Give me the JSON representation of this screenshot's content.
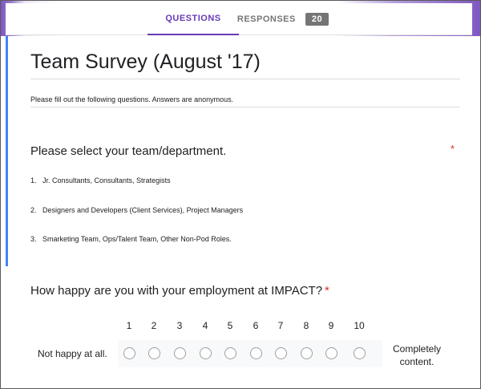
{
  "tabs": {
    "questions_label": "QUESTIONS",
    "responses_label": "RESPONSES",
    "responses_count": "20"
  },
  "form": {
    "title": "Team Survey (August '17)",
    "description": "Please fill out the following questions. Answers are anonymous."
  },
  "question1": {
    "title": "Please select your team/department.",
    "required_mark": "*",
    "options": [
      {
        "num": "1.",
        "label": "Jr. Consultants, Consultants, Strategists"
      },
      {
        "num": "2.",
        "label": "Designers and Developers (Client Services), Project Managers"
      },
      {
        "num": "3.",
        "label": "Smarketing Team, Ops/Talent Team, Other Non-Pod Roles."
      }
    ]
  },
  "question2": {
    "title": "How happy are you with your employment at IMPACT?",
    "required_mark": "*",
    "scale": [
      "1",
      "2",
      "3",
      "4",
      "5",
      "6",
      "7",
      "8",
      "9",
      "10"
    ],
    "low_label": "Not happy at all.",
    "high_label": "Completely content."
  },
  "colors": {
    "accent": "#673ab7",
    "required": "#d93025",
    "focus_bar": "#4285f4"
  }
}
